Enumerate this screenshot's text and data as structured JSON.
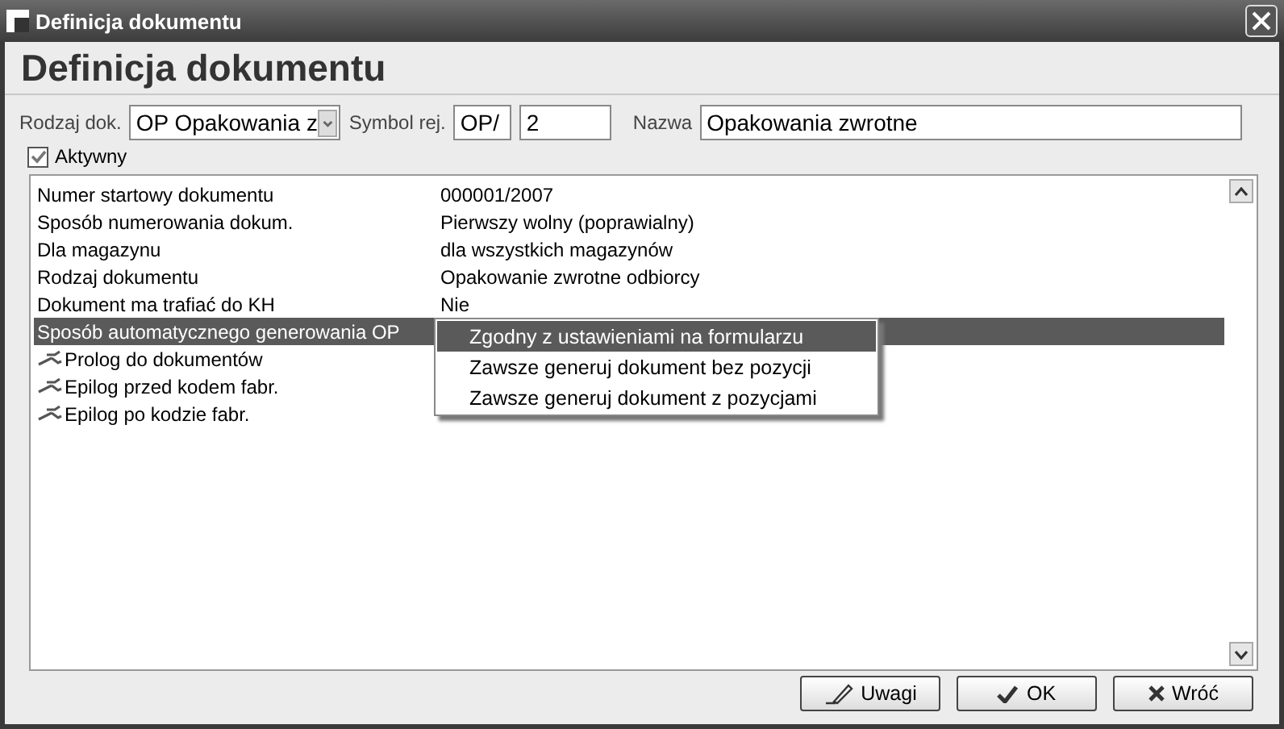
{
  "window": {
    "title": "Definicja dokumentu"
  },
  "heading": "Definicja dokumentu",
  "form": {
    "type_label": "Rodzaj dok.",
    "type_value": "OP Opakowania z",
    "symbol_label": "Symbol rej.",
    "symbol_prefix": "OP/",
    "symbol_number": "2",
    "name_label": "Nazwa",
    "name_value": "Opakowania zwrotne"
  },
  "active": {
    "label": "Aktywny",
    "checked": true
  },
  "properties": [
    {
      "kind": "plain",
      "label": "Numer startowy dokumentu",
      "value": "000001/2007",
      "selected": false
    },
    {
      "kind": "plain",
      "label": "Sposób numerowania dokum.",
      "value": "Pierwszy wolny  (poprawialny)",
      "selected": false
    },
    {
      "kind": "plain",
      "label": "Dla magazynu",
      "value": "dla wszystkich magazynów",
      "selected": false
    },
    {
      "kind": "plain",
      "label": "Rodzaj dokumentu",
      "value": "Opakowanie zwrotne odbiorcy",
      "selected": false
    },
    {
      "kind": "plain",
      "label": "Dokument ma trafiać do KH",
      "value": "Nie",
      "selected": false
    },
    {
      "kind": "plain",
      "label": "Sposób automatycznego generowania OP",
      "selected": true
    },
    {
      "kind": "script",
      "label": "Prolog do dokumentów",
      "selected": false
    },
    {
      "kind": "script",
      "label": "Epilog przed kodem fabr.",
      "selected": false
    },
    {
      "kind": "script",
      "label": "Epilog po kodzie fabr.",
      "selected": false
    }
  ],
  "dropdown": [
    {
      "label": "Zgodny z ustawieniami na formularzu",
      "selected": true
    },
    {
      "label": "Zawsze generuj dokument bez pozycji",
      "selected": false
    },
    {
      "label": "Zawsze generuj dokument z pozycjami",
      "selected": false
    }
  ],
  "buttons": [
    {
      "kind": "notes",
      "label": "Uwagi"
    },
    {
      "kind": "ok",
      "label": "OK"
    },
    {
      "kind": "cancel",
      "label": "Wróć"
    }
  ]
}
